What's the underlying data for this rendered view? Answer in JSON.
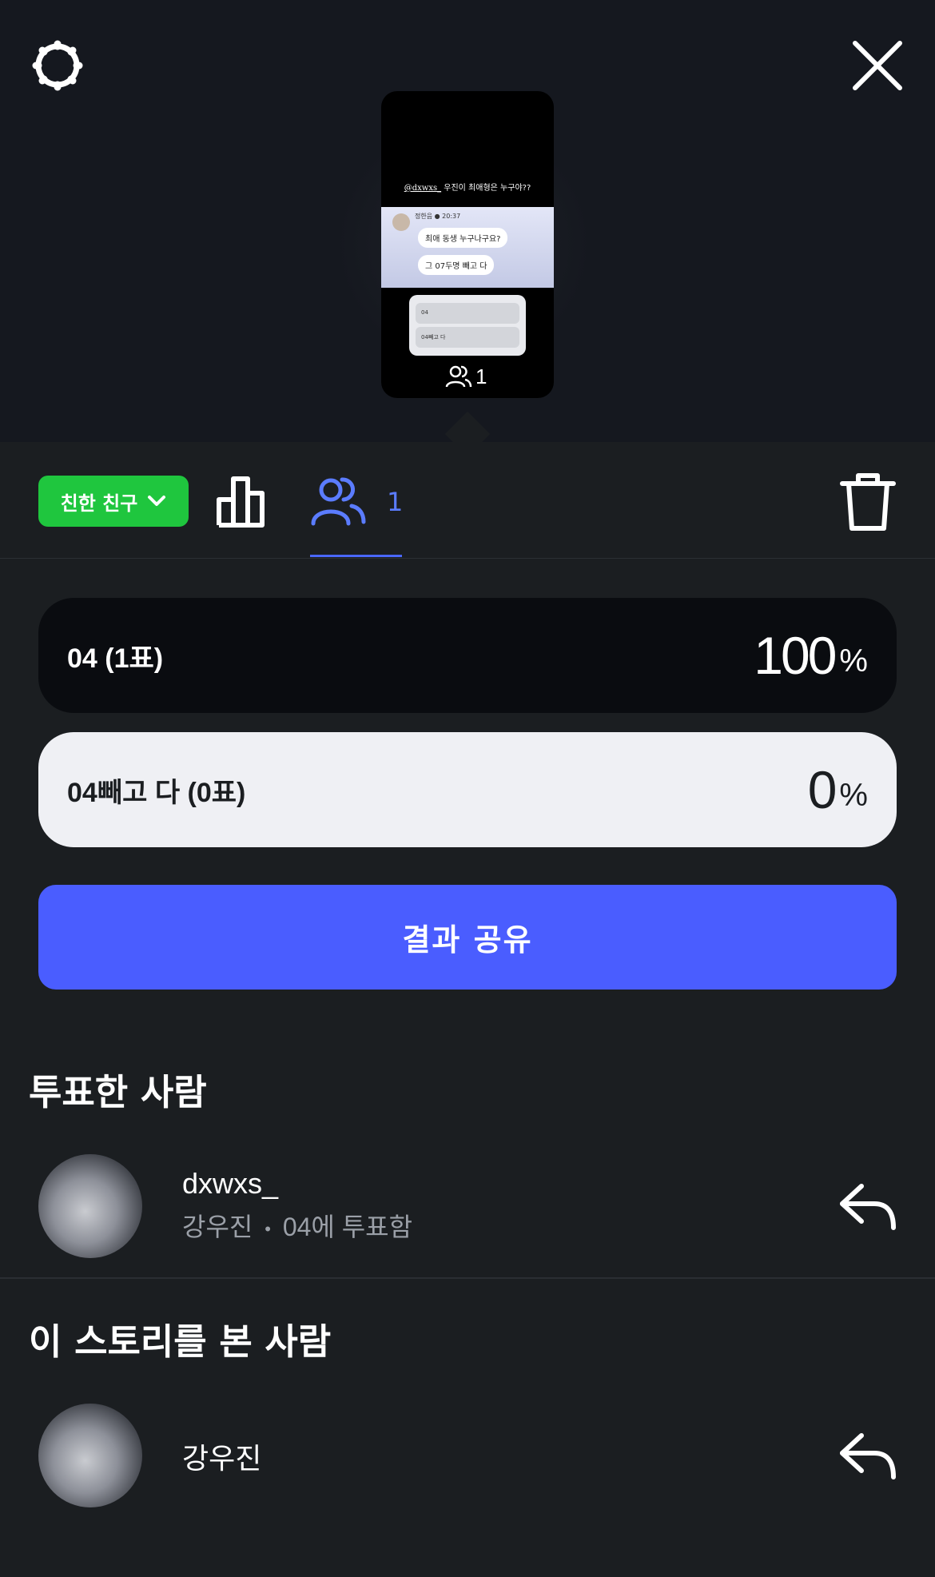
{
  "preview": {
    "caption_handle": "@dxwxs_",
    "caption_text": "우진이 최애형은 누구야??",
    "chat_name": "정한음",
    "chat_time": "20:37",
    "chat_bubble_1": "최애 동생 누구나구요?",
    "chat_bubble_2": "그 07두명 빼고 다",
    "poll_option_1": "04",
    "poll_option_2": "04빼고 다",
    "viewer_count": "1"
  },
  "tabs": {
    "close_friends": "친한 친구",
    "viewers_count": "1"
  },
  "poll_results": [
    {
      "label": "04 (1표)",
      "percent": "100",
      "percent_sign": "%"
    },
    {
      "label": "04빼고 다 (0표)",
      "percent": "0",
      "percent_sign": "%"
    }
  ],
  "share_button": "결과 공유",
  "voters_section": {
    "title": "투표한 사람",
    "items": [
      {
        "username": "dxwxs_",
        "name": "강우진",
        "separator": "•",
        "vote": "04에 투표함"
      }
    ]
  },
  "viewers_section": {
    "title": "이 스토리를 본 사람",
    "items": [
      {
        "name": "강우진"
      }
    ]
  },
  "colors": {
    "accent_blue": "#4a5dff",
    "close_friends_green": "#1fc63e",
    "active_tab": "#5b7cff"
  }
}
